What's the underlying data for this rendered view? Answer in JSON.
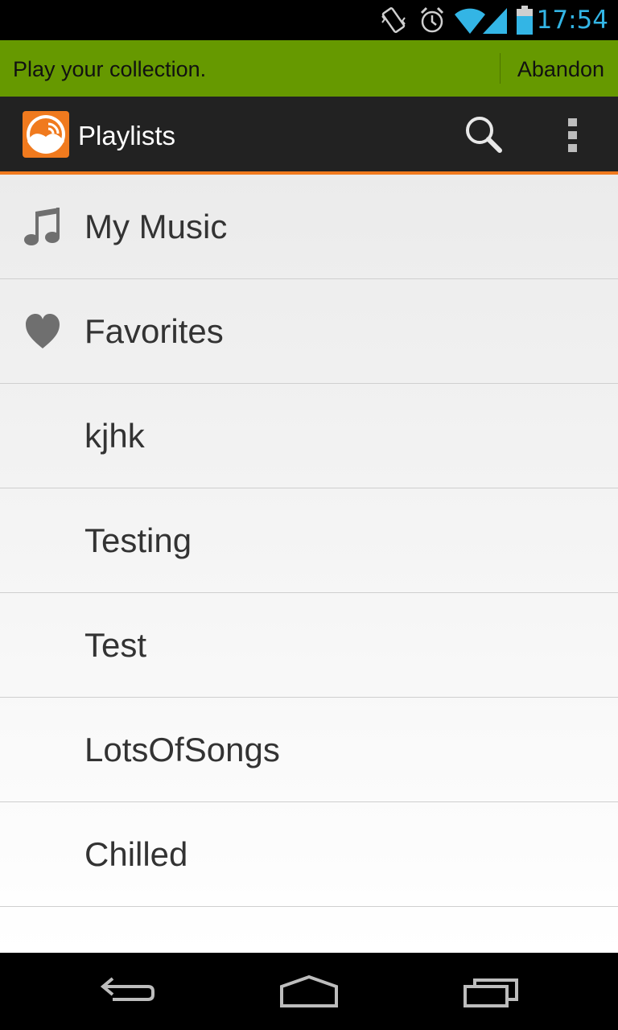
{
  "status_bar": {
    "time": "17:54",
    "icons": [
      "vibrate-icon",
      "alarm-icon",
      "wifi-icon",
      "signal-icon",
      "battery-icon"
    ]
  },
  "banner": {
    "message": "Play your collection.",
    "action_label": "Abandon",
    "color": "#669900"
  },
  "action_bar": {
    "title": "Playlists",
    "icons": [
      "app-logo-icon",
      "search-icon",
      "overflow-menu-icon"
    ],
    "accent_color": "#f07a1e"
  },
  "playlists": [
    {
      "label": "My Music",
      "icon": "music-note-icon"
    },
    {
      "label": "Favorites",
      "icon": "heart-icon"
    },
    {
      "label": "kjhk"
    },
    {
      "label": "Testing"
    },
    {
      "label": "Test"
    },
    {
      "label": "LotsOfSongs"
    },
    {
      "label": "Chilled"
    }
  ],
  "nav_bar": {
    "icons": [
      "back-icon",
      "home-icon",
      "recent-apps-icon"
    ]
  }
}
